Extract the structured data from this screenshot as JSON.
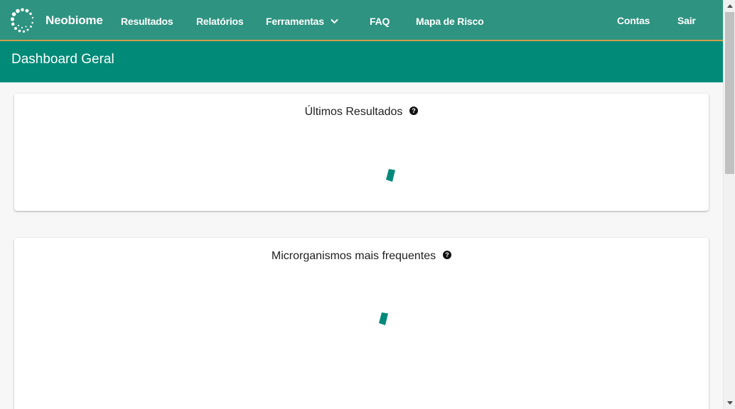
{
  "nav": {
    "brand": "Neobiome",
    "items": [
      {
        "label": "Resultados"
      },
      {
        "label": "Relatórios"
      },
      {
        "label": "Ferramentas"
      },
      {
        "label": "FAQ"
      },
      {
        "label": "Mapa de Risco"
      }
    ],
    "right_items": [
      {
        "label": "Contas"
      },
      {
        "label": "Sair"
      }
    ]
  },
  "subheader": {
    "title": "Dashboard Geral"
  },
  "cards": [
    {
      "title": "Últimos Resultados",
      "help_icon": "question-circle-icon",
      "state_icon": "loading-spinner-icon"
    },
    {
      "title": "Microrganismos mais frequentes",
      "help_icon": "question-circle-icon",
      "state_icon": "loading-spinner-icon"
    }
  ],
  "colors": {
    "navbar": "#2e9380",
    "navbar_border": "#d2a04a",
    "subheader": "#008a77",
    "spinner": "#00897b"
  }
}
